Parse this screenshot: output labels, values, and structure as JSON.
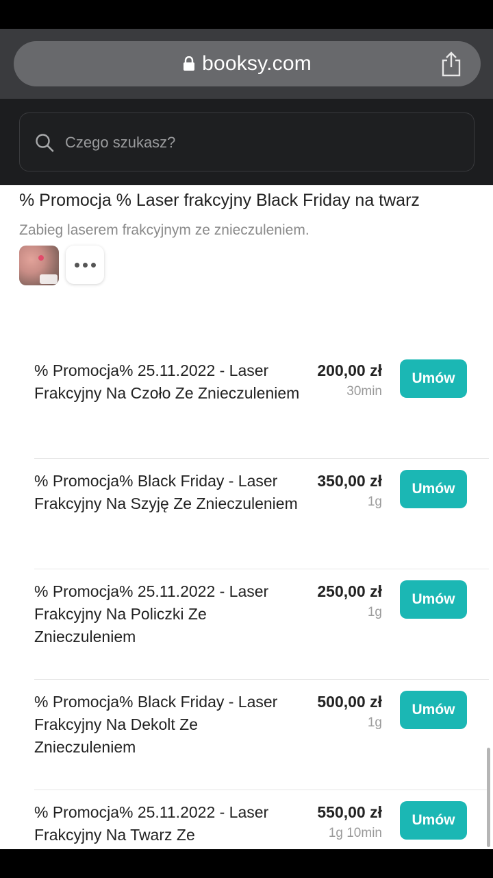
{
  "browser": {
    "url": "booksy.com"
  },
  "search": {
    "placeholder": "Czego szukasz?"
  },
  "page": {
    "title": "% Promocja % Laser frakcyjny Black Friday na twarz",
    "subtitle": "Zabieg laserem frakcyjnym ze znieczuleniem."
  },
  "services": [
    {
      "name": "% Promocja% 25.11.2022 - Laser Frakcyjny Na Czoło Ze Znieczuleniem",
      "price": "200,00 zł",
      "duration": "30min",
      "button": "Umów"
    },
    {
      "name": "% Promocja% Black Friday - Laser Frakcyjny Na Szyję Ze Znieczuleniem",
      "price": "350,00 zł",
      "duration": "1g",
      "button": "Umów"
    },
    {
      "name": "% Promocja% 25.11.2022 - Laser Frakcyjny Na Policzki Ze Znieczuleniem",
      "price": "250,00 zł",
      "duration": "1g",
      "button": "Umów"
    },
    {
      "name": "% Promocja% Black Friday - Laser Frakcyjny Na Dekolt Ze Znieczuleniem",
      "price": "500,00 zł",
      "duration": "1g",
      "button": "Umów"
    },
    {
      "name": "% Promocja% 25.11.2022 - Laser Frakcyjny Na Twarz Ze",
      "price": "550,00 zł",
      "duration": "1g 10min",
      "button": "Umów"
    }
  ],
  "icons": {
    "lock": "lock-icon",
    "share": "share-icon",
    "search": "search-icon",
    "more": "more-icon"
  },
  "colors": {
    "accent": "#1bb7b4",
    "browser_bar": "#3a3b3e",
    "search_bg": "#1c1d1f"
  }
}
